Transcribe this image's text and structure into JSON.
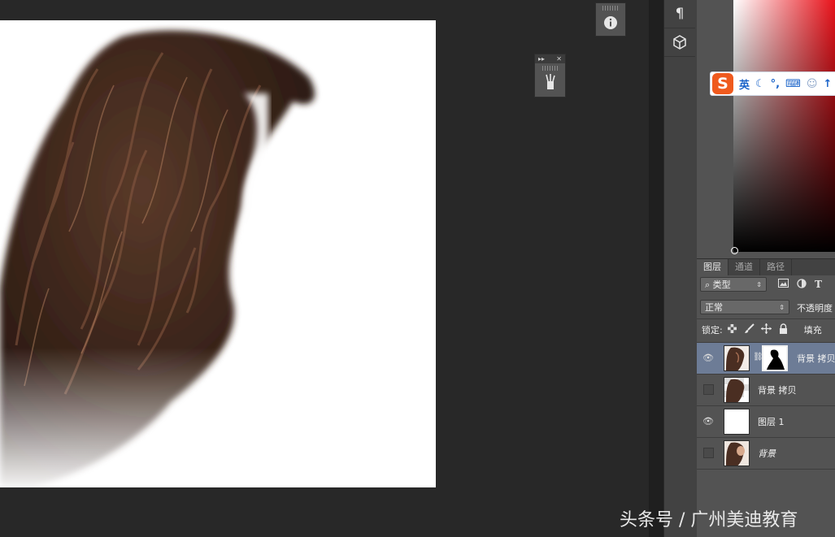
{
  "dock": {
    "paragraph_icon": "pilcrow-icon",
    "cube_icon": "3d-cube-icon"
  },
  "floating": {
    "info_icon": "info-icon",
    "brushes_icon": "brush-presets-icon",
    "clone_icon": "clone-source-icon"
  },
  "ime": {
    "logo": "S",
    "mode": "英",
    "icons": [
      "moon-icon",
      "punctuation-icon",
      "keyboard-icon",
      "user-icon",
      "arrow-icon"
    ]
  },
  "layers_panel": {
    "tabs": [
      {
        "label": "图层",
        "active": true
      },
      {
        "label": "通道",
        "active": false
      },
      {
        "label": "路径",
        "active": false
      }
    ],
    "filter_label": "类型",
    "filter_icon": "search-icon",
    "filter_icons": [
      "image-filter-icon",
      "adjustment-filter-icon",
      "text-filter-icon"
    ],
    "filter_text_glyph": "T",
    "blend_mode": "正常",
    "opacity_label": "不透明度",
    "lock_label": "锁定:",
    "lock_icons": [
      "lock-transparent-icon",
      "lock-brush-icon",
      "lock-move-icon",
      "lock-all-icon"
    ],
    "fill_label": "填充",
    "layers": [
      {
        "name": "背景 拷贝",
        "visible": true,
        "selected": true,
        "has_mask": true,
        "thumb": "hair"
      },
      {
        "name": "背景 拷贝",
        "visible": false,
        "selected": false,
        "has_mask": false,
        "thumb": "hair"
      },
      {
        "name": "图层 1",
        "visible": true,
        "selected": false,
        "has_mask": false,
        "thumb": "white"
      },
      {
        "name": "背景",
        "visible": false,
        "selected": false,
        "has_mask": false,
        "thumb": "portrait",
        "italic": true
      }
    ]
  },
  "watermark": "头条号 / 广州美迪教育",
  "colors": {
    "workspace": "#282828",
    "panel": "#535353",
    "selected_layer": "#6d7c96",
    "picker_hue": "#e8131b"
  }
}
